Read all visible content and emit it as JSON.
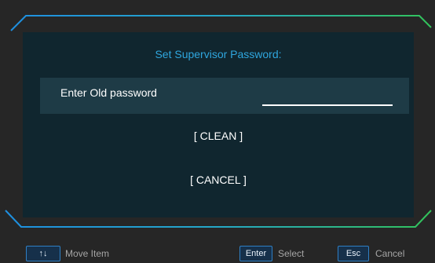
{
  "dialog": {
    "title": "Set Supervisor Password:",
    "field_label": "Enter Old password",
    "field_value": "",
    "buttons": {
      "clean": "[ CLEAN ]",
      "cancel": "[ CANCEL ]"
    }
  },
  "footer": {
    "move": {
      "key": "↑↓",
      "label": "Move Item"
    },
    "select": {
      "key": "Enter",
      "label": "Select"
    },
    "cancel": {
      "key": "Esc",
      "label": "Cancel"
    }
  },
  "colors": {
    "background": "#262626",
    "panel": "#10262f",
    "input_row": "#1e3b46",
    "title": "#2fa6de",
    "frame_left": "#1e8fe0",
    "frame_right": "#32c35a"
  },
  "icons": {
    "frame": "angled-frame-border"
  }
}
